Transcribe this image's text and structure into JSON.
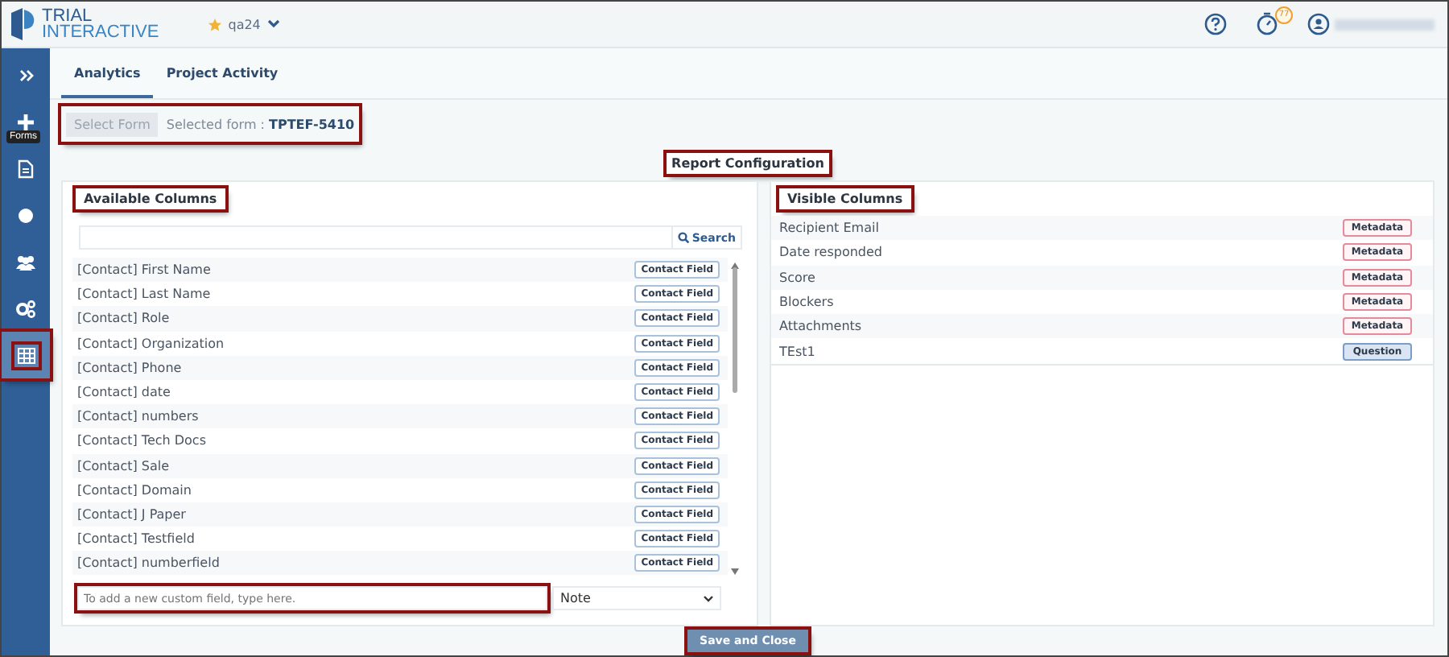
{
  "header": {
    "logo_line1": "TRIAL",
    "logo_line2": "INTERACTIVE",
    "project": "qa24",
    "timer_badge": "77"
  },
  "sidebar": {
    "items": [
      {
        "kind": "chevrons",
        "selected": false,
        "highlighted": false
      },
      {
        "kind": "plus",
        "selected": false,
        "highlighted": false,
        "tooltip": "Forms"
      },
      {
        "kind": "document",
        "selected": false,
        "highlighted": false
      },
      {
        "kind": "circle",
        "selected": false,
        "highlighted": false
      },
      {
        "kind": "users",
        "selected": false,
        "highlighted": false
      },
      {
        "kind": "gears",
        "selected": false,
        "highlighted": false
      },
      {
        "kind": "grid",
        "selected": true,
        "highlighted": true
      }
    ]
  },
  "tabs": [
    {
      "label": "Analytics",
      "selected": true
    },
    {
      "label": "Project Activity",
      "selected": false
    }
  ],
  "form_picker": {
    "button": "Select Form",
    "label": "Selected form : ",
    "value": "TPTEF-5410",
    "highlighted": true
  },
  "section_title": {
    "text": "Report Configuration",
    "highlighted": true
  },
  "available": {
    "title": "Available Columns",
    "highlighted": true,
    "search_button": "Search",
    "rows": [
      {
        "name": "[Contact] First Name",
        "tag": "Contact Field",
        "kind": "contact"
      },
      {
        "name": "[Contact] Last Name",
        "tag": "Contact Field",
        "kind": "contact"
      },
      {
        "name": "[Contact] Role",
        "tag": "Contact Field",
        "kind": "contact"
      },
      {
        "name": "[Contact] Organization",
        "tag": "Contact Field",
        "kind": "contact"
      },
      {
        "name": "[Contact] Phone",
        "tag": "Contact Field",
        "kind": "contact"
      },
      {
        "name": "[Contact] date",
        "tag": "Contact Field",
        "kind": "contact"
      },
      {
        "name": "[Contact] numbers",
        "tag": "Contact Field",
        "kind": "contact"
      },
      {
        "name": "[Contact] Tech Docs",
        "tag": "Contact Field",
        "kind": "contact"
      },
      {
        "name": "[Contact] Sale",
        "tag": "Contact Field",
        "kind": "contact"
      },
      {
        "name": "[Contact] Domain",
        "tag": "Contact Field",
        "kind": "contact"
      },
      {
        "name": "[Contact] J Paper",
        "tag": "Contact Field",
        "kind": "contact"
      },
      {
        "name": "[Contact] Testfield",
        "tag": "Contact Field",
        "kind": "contact"
      },
      {
        "name": "[Contact] numberfield",
        "tag": "Contact Field",
        "kind": "contact"
      }
    ],
    "custom_field": {
      "placeholder": "To add a new custom field, type here.",
      "highlighted": true
    },
    "type_select": "Note"
  },
  "visible": {
    "title": "Visible Columns",
    "highlighted": true,
    "rows": [
      {
        "name": "Recipient Email",
        "tag": "Metadata",
        "kind": "metadata"
      },
      {
        "name": "Date responded",
        "tag": "Metadata",
        "kind": "metadata"
      },
      {
        "name": "Score",
        "tag": "Metadata",
        "kind": "metadata"
      },
      {
        "name": "Blockers",
        "tag": "Metadata",
        "kind": "metadata"
      },
      {
        "name": "Attachments",
        "tag": "Metadata",
        "kind": "metadata"
      },
      {
        "name": "TEst1",
        "tag": "Question",
        "kind": "question"
      }
    ]
  },
  "footer": {
    "button": "Save and Close",
    "highlighted": true
  }
}
